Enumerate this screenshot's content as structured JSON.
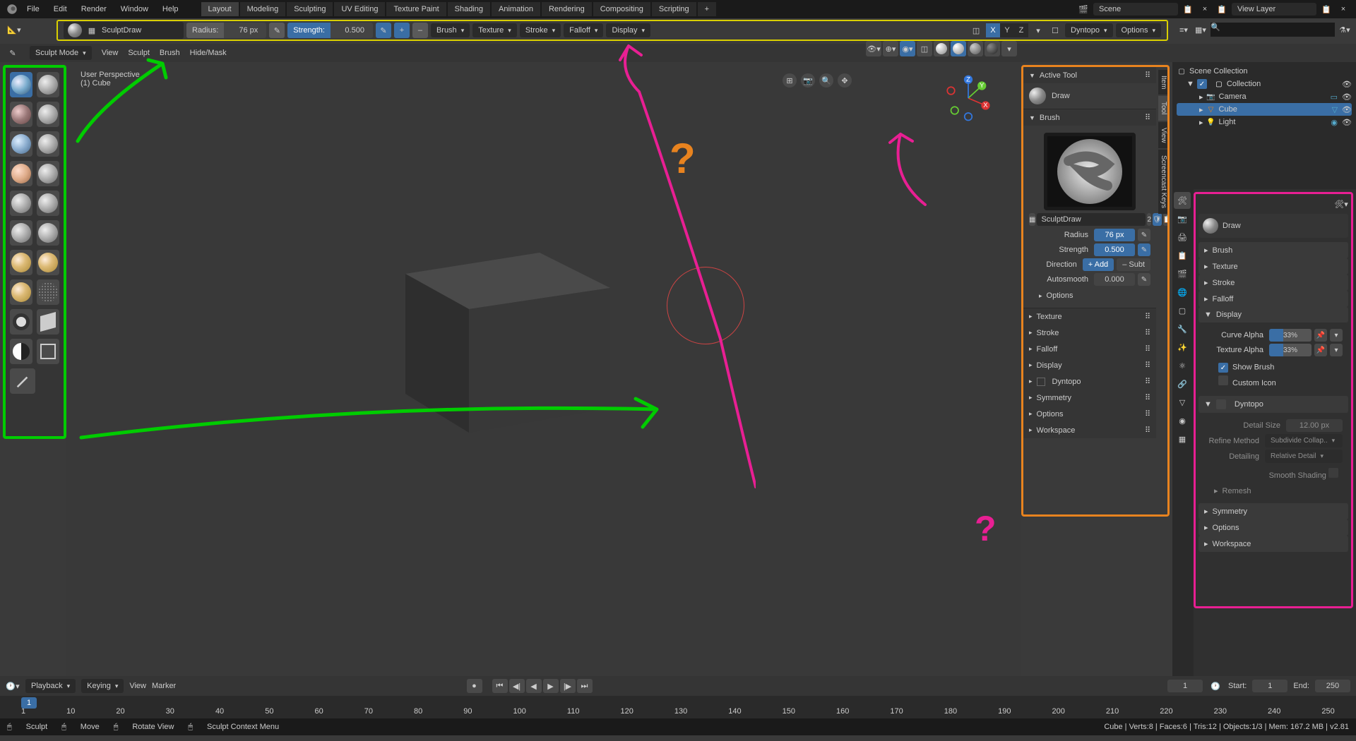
{
  "topbar": {
    "menus": [
      "File",
      "Edit",
      "Render",
      "Window",
      "Help"
    ],
    "tabs": [
      "Layout",
      "Modeling",
      "Sculpting",
      "UV Editing",
      "Texture Paint",
      "Shading",
      "Animation",
      "Rendering",
      "Compositing",
      "Scripting"
    ],
    "active_tab": "Layout",
    "scene": "Scene",
    "view_layer": "View Layer"
  },
  "toolheader": {
    "brush_name": "SculptDraw",
    "radius_label": "Radius:",
    "radius_value": "76 px",
    "strength_label": "Strength:",
    "strength_value": "0.500",
    "dropdowns": [
      "Brush",
      "Texture",
      "Stroke",
      "Falloff",
      "Display"
    ],
    "xyz": [
      "X",
      "Y",
      "Z"
    ],
    "dyntopo": "Dyntopo",
    "options": "Options"
  },
  "header3": {
    "mode": "Sculpt Mode",
    "menus": [
      "View",
      "Sculpt",
      "Brush",
      "Hide/Mask"
    ]
  },
  "viewport": {
    "perspective": "User Perspective",
    "object": "(1) Cube"
  },
  "npanel": {
    "vtabs": [
      "Item",
      "Tool",
      "View",
      "Screencast Keys"
    ],
    "active_tool_hdr": "Active Tool",
    "tool_name": "Draw",
    "brush_hdr": "Brush",
    "brush_name": "SculptDraw",
    "brush_users": "2",
    "radius_lbl": "Radius",
    "radius_val": "76 px",
    "strength_lbl": "Strength",
    "strength_val": "0.500",
    "direction_lbl": "Direction",
    "dir_add": "+ Add",
    "dir_sub": "– Subt",
    "autosmooth_lbl": "Autosmooth",
    "autosmooth_val": "0.000",
    "sections": [
      "Options",
      "Texture",
      "Stroke",
      "Falloff",
      "Display",
      "Dyntopo",
      "Symmetry",
      "Options",
      "Workspace"
    ]
  },
  "outliner": {
    "root": "Scene Collection",
    "collection": "Collection",
    "items": [
      "Camera",
      "Cube",
      "Light"
    ]
  },
  "props": {
    "tool_name": "Draw",
    "sections_collapsed": [
      "Brush",
      "Texture",
      "Stroke",
      "Falloff"
    ],
    "display_hdr": "Display",
    "curve_alpha_lbl": "Curve Alpha",
    "curve_alpha_val": "33%",
    "tex_alpha_lbl": "Texture Alpha",
    "tex_alpha_val": "33%",
    "show_brush": "Show Brush",
    "custom_icon": "Custom Icon",
    "dyntopo_hdr": "Dyntopo",
    "detail_size_lbl": "Detail Size",
    "detail_size_val": "12.00 px",
    "refine_lbl": "Refine Method",
    "refine_val": "Subdivide Collap..",
    "detailing_lbl": "Detailing",
    "detailing_val": "Relative Detail",
    "smooth_shading": "Smooth Shading",
    "remesh": "Remesh",
    "sections_bottom": [
      "Symmetry",
      "Options",
      "Workspace"
    ]
  },
  "timeline": {
    "menus": [
      "Playback",
      "Keying",
      "View",
      "Marker"
    ],
    "current": "1",
    "start_lbl": "Start:",
    "start": "1",
    "end_lbl": "End:",
    "end": "250",
    "ticks": [
      "1",
      "10",
      "20",
      "30",
      "40",
      "50",
      "60",
      "70",
      "80",
      "90",
      "100",
      "110",
      "120",
      "130",
      "140",
      "150",
      "160",
      "170",
      "180",
      "190",
      "200",
      "210",
      "220",
      "230",
      "240",
      "250"
    ]
  },
  "statusbar": {
    "left1": "Sculpt",
    "left2": "Move",
    "mid1": "Rotate View",
    "mid2": "Sculpt Context Menu",
    "right": "Cube | Verts:8 | Faces:6 | Tris:12 | Objects:1/3 | Mem: 167.2 MB | v2.81"
  }
}
